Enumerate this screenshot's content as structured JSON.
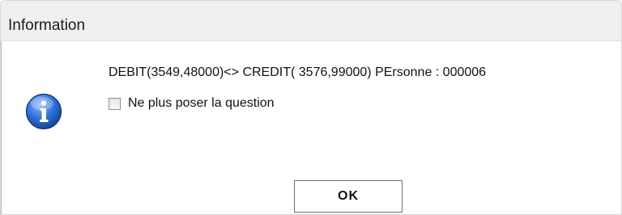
{
  "dialog": {
    "title": "Information",
    "message": "DEBIT(3549,48000)<> CREDIT( 3576,99000) PErsonne : 000006",
    "checkbox_label": "Ne plus poser la question",
    "checkbox_checked": false,
    "ok_label": "OK",
    "icon": "info-icon"
  },
  "colors": {
    "titlebar_bg": "#f0f0f0",
    "icon_blue": "#1f5fbf"
  }
}
